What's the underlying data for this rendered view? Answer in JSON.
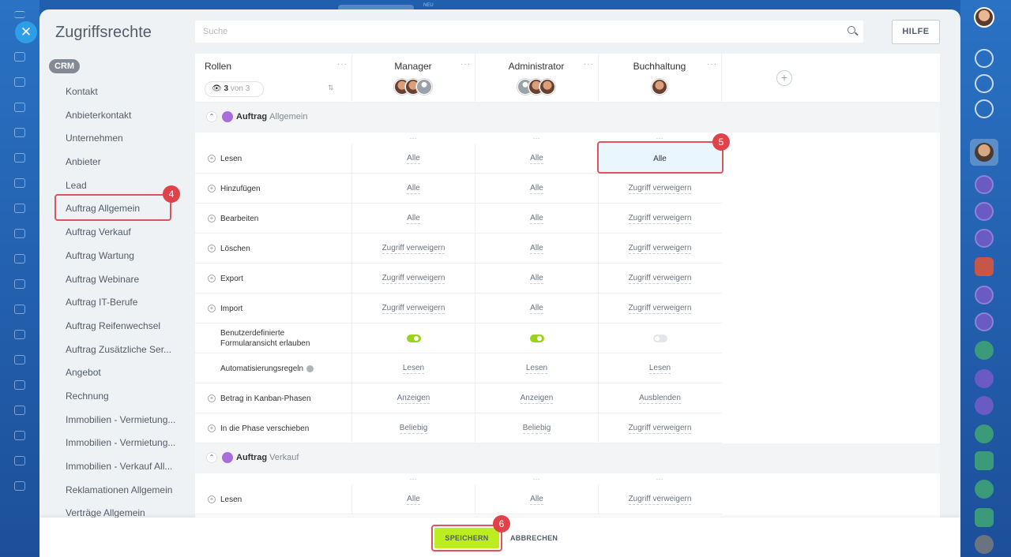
{
  "panel": {
    "title": "Zugriffsrechte",
    "search_placeholder": "Suche",
    "help_label": "HILFE",
    "top_badge": "NEU"
  },
  "sidebar": {
    "group": "CRM",
    "items": [
      "Kontakt",
      "Anbieterkontakt",
      "Unternehmen",
      "Anbieter",
      "Lead",
      "Auftrag Allgemein",
      "Auftrag Verkauf",
      "Auftrag Wartung",
      "Auftrag Webinare",
      "Auftrag IT-Berufe",
      "Auftrag Reifenwechsel",
      "Auftrag Zusätzliche Ser...",
      "Angebot",
      "Rechnung",
      "Immobilien - Vermietung...",
      "Immobilien - Vermietung...",
      "Immobilien - Verkauf All...",
      "Reklamationen Allgemein",
      "Verträge Allgemein"
    ],
    "selected_index": 5
  },
  "table": {
    "roles_label": "Rollen",
    "role_filter": {
      "count": "3",
      "of": "von 3"
    },
    "columns": [
      "Manager",
      "Administrator",
      "Buchhaltung"
    ],
    "dots": "···",
    "sections": [
      {
        "entity": "Auftrag",
        "name": "Allgemein",
        "rows": [
          {
            "label": "Lesen",
            "values": [
              "Alle",
              "Alle",
              "Alle"
            ]
          },
          {
            "label": "Hinzufügen",
            "values": [
              "Alle",
              "Alle",
              "Zugriff verweigern"
            ]
          },
          {
            "label": "Bearbeiten",
            "values": [
              "Alle",
              "Alle",
              "Zugriff verweigern"
            ]
          },
          {
            "label": "Löschen",
            "values": [
              "Zugriff verweigern",
              "Alle",
              "Zugriff verweigern"
            ]
          },
          {
            "label": "Export",
            "values": [
              "Zugriff verweigern",
              "Alle",
              "Zugriff verweigern"
            ]
          },
          {
            "label": "Import",
            "values": [
              "Zugriff verweigern",
              "Alle",
              "Zugriff verweigern"
            ]
          },
          {
            "label": "Benutzerdefinierte Formularansicht erlauben",
            "toggles": [
              true,
              true,
              false
            ]
          },
          {
            "label": "Automatisierungsregeln",
            "values": [
              "Lesen",
              "Lesen",
              "Lesen"
            ]
          },
          {
            "label": "Betrag in Kanban-Phasen",
            "values": [
              "Anzeigen",
              "Anzeigen",
              "Ausblenden"
            ]
          },
          {
            "label": "In die Phase verschieben",
            "values": [
              "Beliebig",
              "Beliebig",
              "Zugriff verweigern"
            ]
          }
        ]
      },
      {
        "entity": "Auftrag",
        "name": "Verkauf",
        "rows": [
          {
            "label": "Lesen",
            "values": [
              "Alle",
              "Alle",
              "Zugriff verweigern"
            ]
          }
        ]
      }
    ]
  },
  "footer": {
    "save_label": "SPEICHERN",
    "cancel_label": "ABBRECHEN"
  },
  "steps": [
    "4",
    "5",
    "6"
  ],
  "colors": {
    "accent_save": "#bbed21",
    "highlight": "#e0535b",
    "step_badge": "#e0424a",
    "selected_cell": "#e9f6fe",
    "toggle_on": "#9bd316"
  }
}
